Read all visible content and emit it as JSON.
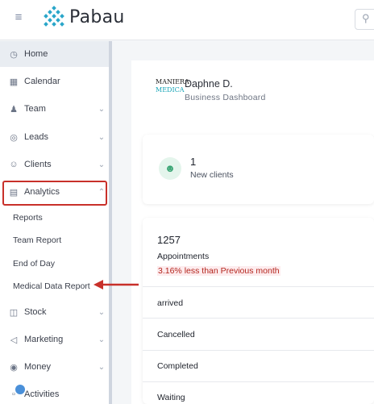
{
  "topbar": {
    "brand": "Pabau",
    "icons": [
      "menu-icon",
      "search-icon"
    ]
  },
  "sidebar": {
    "items": [
      {
        "label": "Home",
        "icon": "clock-icon"
      },
      {
        "label": "Calendar",
        "icon": "calendar-icon"
      },
      {
        "label": "Team",
        "icon": "team-icon"
      },
      {
        "label": "Leads",
        "icon": "target-icon"
      },
      {
        "label": "Clients",
        "icon": "person-icon"
      },
      {
        "label": "Analytics",
        "icon": "report-icon"
      },
      {
        "label": "Stock",
        "icon": "cart-icon"
      },
      {
        "label": "Marketing",
        "icon": "megaphone-icon"
      },
      {
        "label": "Money",
        "icon": "dollar-icon"
      },
      {
        "label": "Activities",
        "icon": "activities-icon"
      }
    ],
    "analytics_sub": [
      {
        "label": "Reports"
      },
      {
        "label": "Team Report"
      },
      {
        "label": "End of Day"
      },
      {
        "label": "Medical Data Report"
      }
    ]
  },
  "business": {
    "logo_line1": "MANIERA",
    "logo_line2": "MEDICA",
    "name": "Daphne D.",
    "subtitle": "Business Dashboard"
  },
  "new_clients": {
    "value": "1",
    "label": "New clients"
  },
  "appointments": {
    "value": "1257",
    "label": "Appointments",
    "delta": "3.16% less than Previous month",
    "rows": [
      {
        "label": "arrived"
      },
      {
        "label": "Cancelled"
      },
      {
        "label": "Completed"
      },
      {
        "label": "Waiting"
      }
    ]
  },
  "colors": {
    "highlight": "#c8302a",
    "brand_teal": "#1aa5b8"
  }
}
